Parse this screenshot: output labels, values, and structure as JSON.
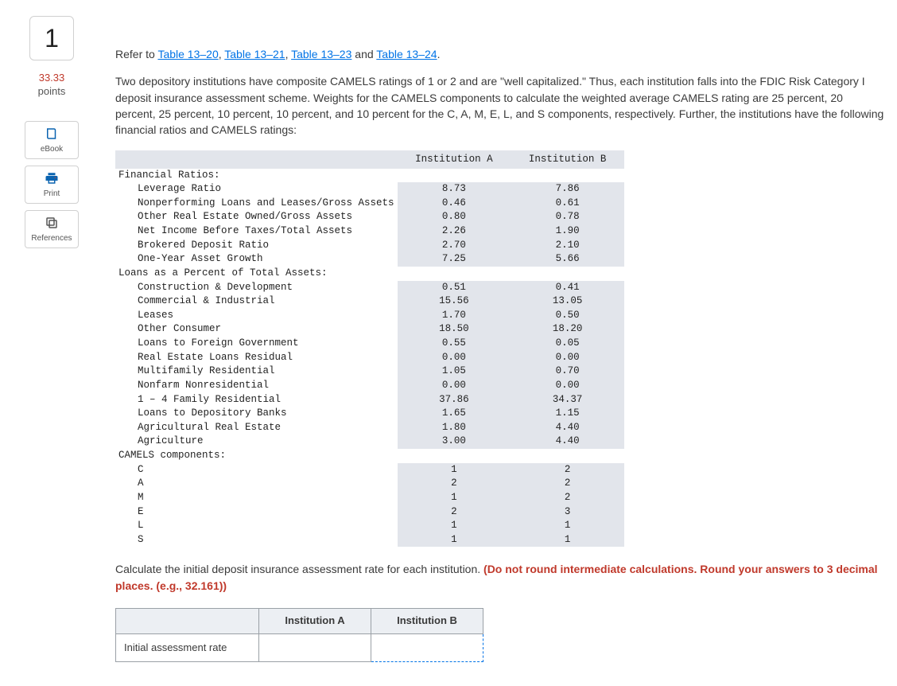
{
  "question": {
    "number": "1",
    "points_value": "33.33",
    "points_label": "points"
  },
  "sidebar": {
    "ebook": "eBook",
    "print": "Print",
    "references": "References"
  },
  "refer": {
    "prefix": "Refer to ",
    "links": [
      "Table 13–20",
      "Table 13–21",
      "Table 13–23",
      "Table 13–24"
    ],
    "suffix": "."
  },
  "intro": "Two depository institutions have composite CAMELS ratings of 1 or 2 and are \"well capitalized.\" Thus, each institution falls into the FDIC Risk Category I deposit insurance assessment scheme. Weights for the CAMELS components to calculate the weighted average CAMELS rating are 25 percent, 20 percent, 25 percent, 10 percent, 10 percent, and 10 percent for the C, A, M, E, L, and S components, respectively. Further, the institutions have the following financial ratios and CAMELS ratings:",
  "table": {
    "col_a": "Institution A",
    "col_b": "Institution B",
    "sections": [
      {
        "header": "Financial Ratios:",
        "rows": [
          {
            "label": "Leverage Ratio",
            "a": "8.73",
            "b": "7.86"
          },
          {
            "label": "Nonperforming Loans and Leases/Gross Assets",
            "a": "0.46",
            "b": "0.61"
          },
          {
            "label": "Other Real Estate Owned/Gross Assets",
            "a": "0.80",
            "b": "0.78"
          },
          {
            "label": "Net Income Before Taxes/Total Assets",
            "a": "2.26",
            "b": "1.90"
          },
          {
            "label": "Brokered Deposit Ratio",
            "a": "2.70",
            "b": "2.10"
          },
          {
            "label": "One-Year Asset Growth",
            "a": "7.25",
            "b": "5.66"
          }
        ]
      },
      {
        "header": "Loans as a Percent of Total Assets:",
        "rows": [
          {
            "label": "Construction & Development",
            "a": "0.51",
            "b": "0.41"
          },
          {
            "label": "Commercial & Industrial",
            "a": "15.56",
            "b": "13.05"
          },
          {
            "label": "Leases",
            "a": "1.70",
            "b": "0.50"
          },
          {
            "label": "Other Consumer",
            "a": "18.50",
            "b": "18.20"
          },
          {
            "label": "Loans to Foreign Government",
            "a": "0.55",
            "b": "0.05"
          },
          {
            "label": "Real Estate Loans Residual",
            "a": "0.00",
            "b": "0.00"
          },
          {
            "label": "Multifamily Residential",
            "a": "1.05",
            "b": "0.70"
          },
          {
            "label": "Nonfarm Nonresidential",
            "a": "0.00",
            "b": "0.00"
          },
          {
            "label": "1 – 4 Family Residential",
            "a": "37.86",
            "b": "34.37"
          },
          {
            "label": "Loans to Depository Banks",
            "a": "1.65",
            "b": "1.15"
          },
          {
            "label": "Agricultural Real Estate",
            "a": "1.80",
            "b": "4.40"
          },
          {
            "label": "Agriculture",
            "a": "3.00",
            "b": "4.40"
          }
        ]
      },
      {
        "header": "CAMELS components:",
        "rows": [
          {
            "label": "C",
            "a": "1",
            "b": "2"
          },
          {
            "label": "A",
            "a": "2",
            "b": "2"
          },
          {
            "label": "M",
            "a": "1",
            "b": "2"
          },
          {
            "label": "E",
            "a": "2",
            "b": "3"
          },
          {
            "label": "L",
            "a": "1",
            "b": "1"
          },
          {
            "label": "S",
            "a": "1",
            "b": "1"
          }
        ]
      }
    ]
  },
  "prompt": {
    "text": "Calculate the initial deposit insurance assessment rate for each institution. ",
    "hint": "(Do not round intermediate calculations. Round your answers to 3 decimal places. (e.g., 32.161))"
  },
  "answer_grid": {
    "blank_header": "",
    "col_a": "Institution A",
    "col_b": "Institution B",
    "row_label": "Initial assessment rate"
  }
}
